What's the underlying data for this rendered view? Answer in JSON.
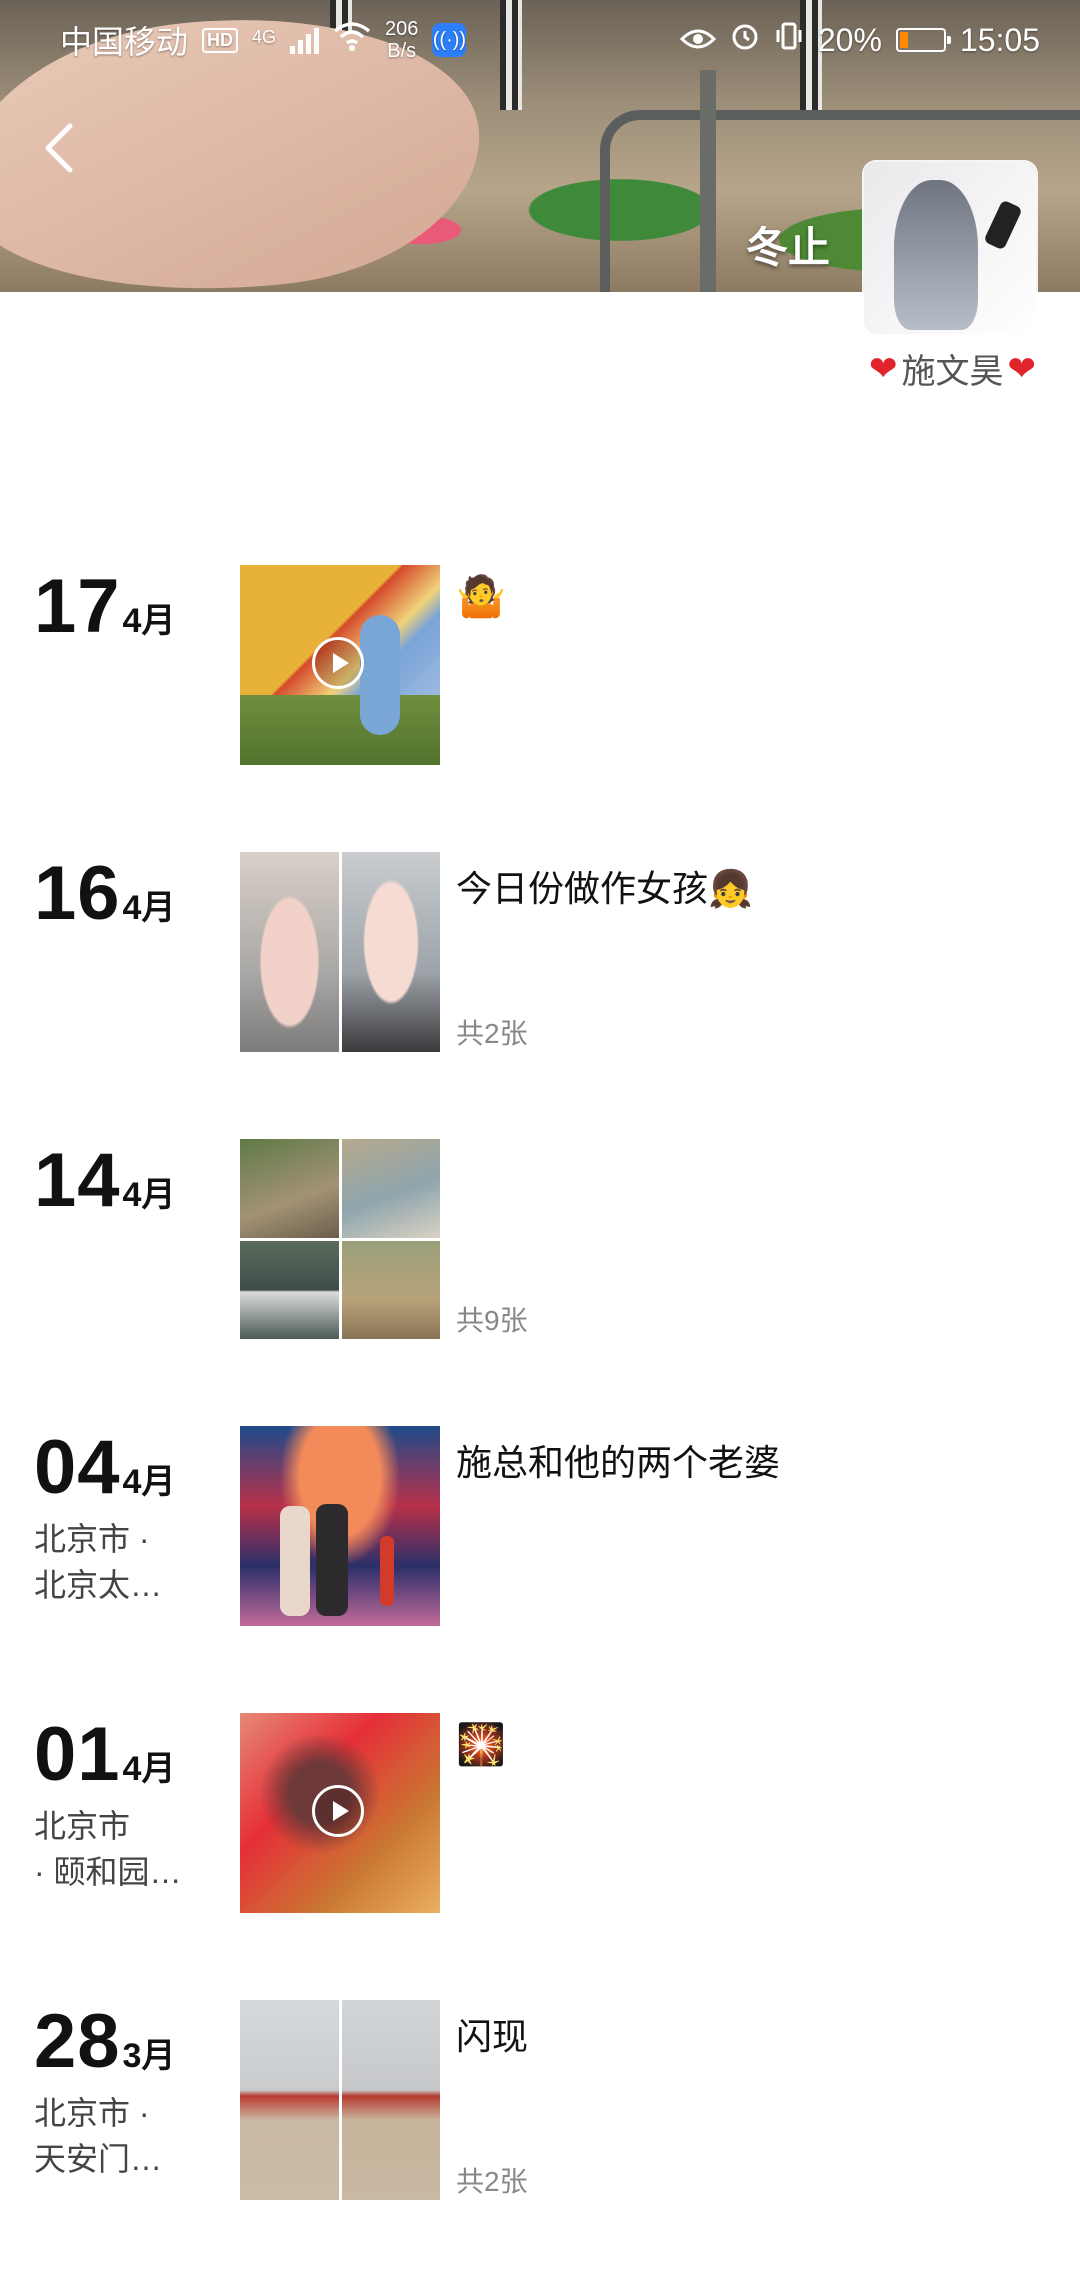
{
  "status_bar": {
    "carrier": "中国移动",
    "hd": "HD",
    "network": "4G",
    "speed_value": "206",
    "speed_unit": "B/s",
    "battery": "20%",
    "time": "15:05"
  },
  "profile": {
    "name": "冬止",
    "signature_text": "施文昊",
    "signature_heart": "❤"
  },
  "entries": [
    {
      "day": "17",
      "month": "4月",
      "location1": "",
      "location2": "",
      "caption": "🤷",
      "count": "",
      "media": "video"
    },
    {
      "day": "16",
      "month": "4月",
      "location1": "",
      "location2": "",
      "caption": "今日份做作女孩👧",
      "count": "共2张",
      "media": "two"
    },
    {
      "day": "14",
      "month": "4月",
      "location1": "",
      "location2": "",
      "caption": "",
      "count": "共9张",
      "media": "grid"
    },
    {
      "day": "04",
      "month": "4月",
      "location1": "北京市 ·",
      "location2": "北京太…",
      "caption": "施总和他的两个老婆",
      "count": "",
      "media": "single"
    },
    {
      "day": "01",
      "month": "4月",
      "location1": "北京市",
      "location2": "· 颐和园…",
      "caption": "🎇",
      "count": "",
      "media": "video"
    },
    {
      "day": "28",
      "month": "3月",
      "location1": "北京市 ·",
      "location2": "天安门…",
      "caption": "闪现",
      "count": "共2张",
      "media": "two"
    }
  ],
  "colors": {
    "heart": "#e0242c",
    "accent_orange": "#ff8a00"
  }
}
